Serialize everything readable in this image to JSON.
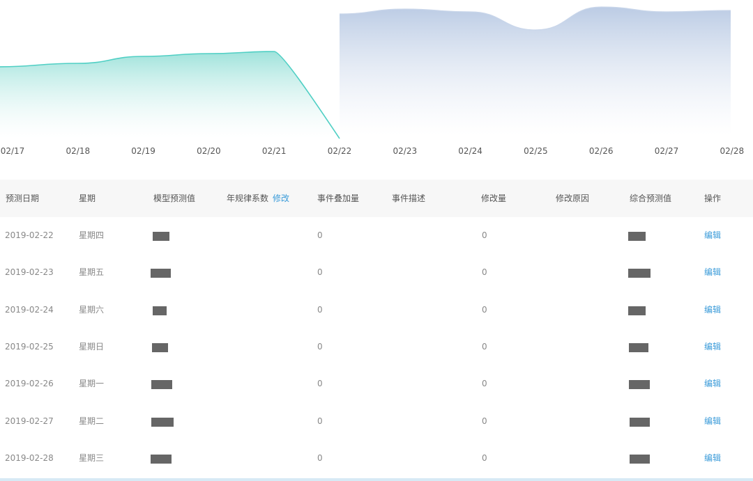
{
  "chart_data": {
    "type": "area",
    "x_labels": [
      "02/17",
      "02/18",
      "02/19",
      "02/20",
      "02/21",
      "02/22",
      "02/23",
      "02/24",
      "02/25",
      "02/26",
      "02/27",
      "02/28"
    ],
    "series": [
      {
        "color": "#4fcfc4",
        "x": [
          "02/17",
          "02/18",
          "02/19",
          "02/20",
          "02/21",
          "02/22"
        ],
        "values": [
          96,
          91,
          81,
          77,
          74,
          199
        ]
      },
      {
        "color": "#b8c9e3",
        "x": [
          "02/22",
          "02/23",
          "02/24",
          "02/25",
          "02/26",
          "02/27",
          "02/28"
        ],
        "values": [
          20,
          13,
          17,
          43,
          10,
          17,
          15
        ]
      }
    ],
    "grid": false,
    "legend": "none"
  },
  "table": {
    "headers": {
      "date": "预测日期",
      "weekday": "星期",
      "model_forecast": "模型预测值",
      "annual_coef": "年规律系数",
      "annual_coef_edit": "修改",
      "event_overlay": "事件叠加量",
      "event_desc": "事件描述",
      "adjust_amount": "修改量",
      "adjust_reason": "修改原因",
      "combined_forecast": "综合预测值",
      "action": "操作"
    },
    "rows": [
      {
        "date": "2019-02-22",
        "weekday": "星期四",
        "event_overlay": "0",
        "adjust_amount": "0",
        "action": "编辑"
      },
      {
        "date": "2019-02-23",
        "weekday": "星期五",
        "event_overlay": "0",
        "adjust_amount": "0",
        "action": "编辑"
      },
      {
        "date": "2019-02-24",
        "weekday": "星期六",
        "event_overlay": "0",
        "adjust_amount": "0",
        "action": "编辑"
      },
      {
        "date": "2019-02-25",
        "weekday": "星期日",
        "event_overlay": "0",
        "adjust_amount": "0",
        "action": "编辑"
      },
      {
        "date": "2019-02-26",
        "weekday": "星期一",
        "event_overlay": "0",
        "adjust_amount": "0",
        "action": "编辑"
      },
      {
        "date": "2019-02-27",
        "weekday": "星期二",
        "event_overlay": "0",
        "adjust_amount": "0",
        "action": "编辑"
      },
      {
        "date": "2019-02-28",
        "weekday": "星期三",
        "event_overlay": "0",
        "adjust_amount": "0",
        "action": "编辑"
      }
    ]
  },
  "colors": {
    "link": "#3a9bd9",
    "header_bg": "#f7f7f7",
    "redaction": "#666666"
  }
}
